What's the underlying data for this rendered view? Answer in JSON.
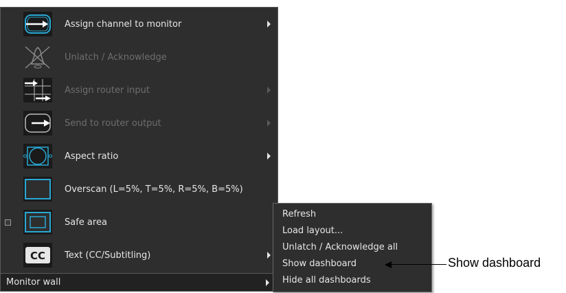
{
  "menu": {
    "items": [
      {
        "label": "Assign channel to monitor",
        "icon": "assign-channel-icon",
        "enabled": true,
        "submenu": true
      },
      {
        "label": "Unlatch / Acknowledge",
        "icon": "unlatch-icon",
        "enabled": false,
        "submenu": false
      },
      {
        "label": "Assign router input",
        "icon": "router-input-icon",
        "enabled": false,
        "submenu": true
      },
      {
        "label": "Send to router output",
        "icon": "router-output-icon",
        "enabled": false,
        "submenu": true
      },
      {
        "label": "Aspect ratio",
        "icon": "aspect-ratio-icon",
        "enabled": true,
        "submenu": true
      },
      {
        "label": "Overscan (L=5%, T=5%, R=5%, B=5%)",
        "icon": "overscan-icon",
        "enabled": true,
        "submenu": false
      },
      {
        "label": "Safe area",
        "icon": "safe-area-icon",
        "enabled": true,
        "submenu": false,
        "checkbox": true
      },
      {
        "label": "Text (CC/Subtitling)",
        "icon": "cc-icon",
        "enabled": true,
        "submenu": true,
        "icon_text": "CC"
      }
    ],
    "footer": {
      "label": "Monitor wall"
    }
  },
  "submenu": {
    "items": [
      "Refresh",
      "Load layout...",
      "Unlatch / Acknowledge all",
      "Show dashboard",
      "Hide all dashboards"
    ]
  },
  "callout": {
    "text": "Show dashboard"
  },
  "colors": {
    "accent": "#29a9d6",
    "menu_bg": "#2e2e2e",
    "text": "#e6e6e6",
    "disabled_text": "#6e6e6e"
  }
}
